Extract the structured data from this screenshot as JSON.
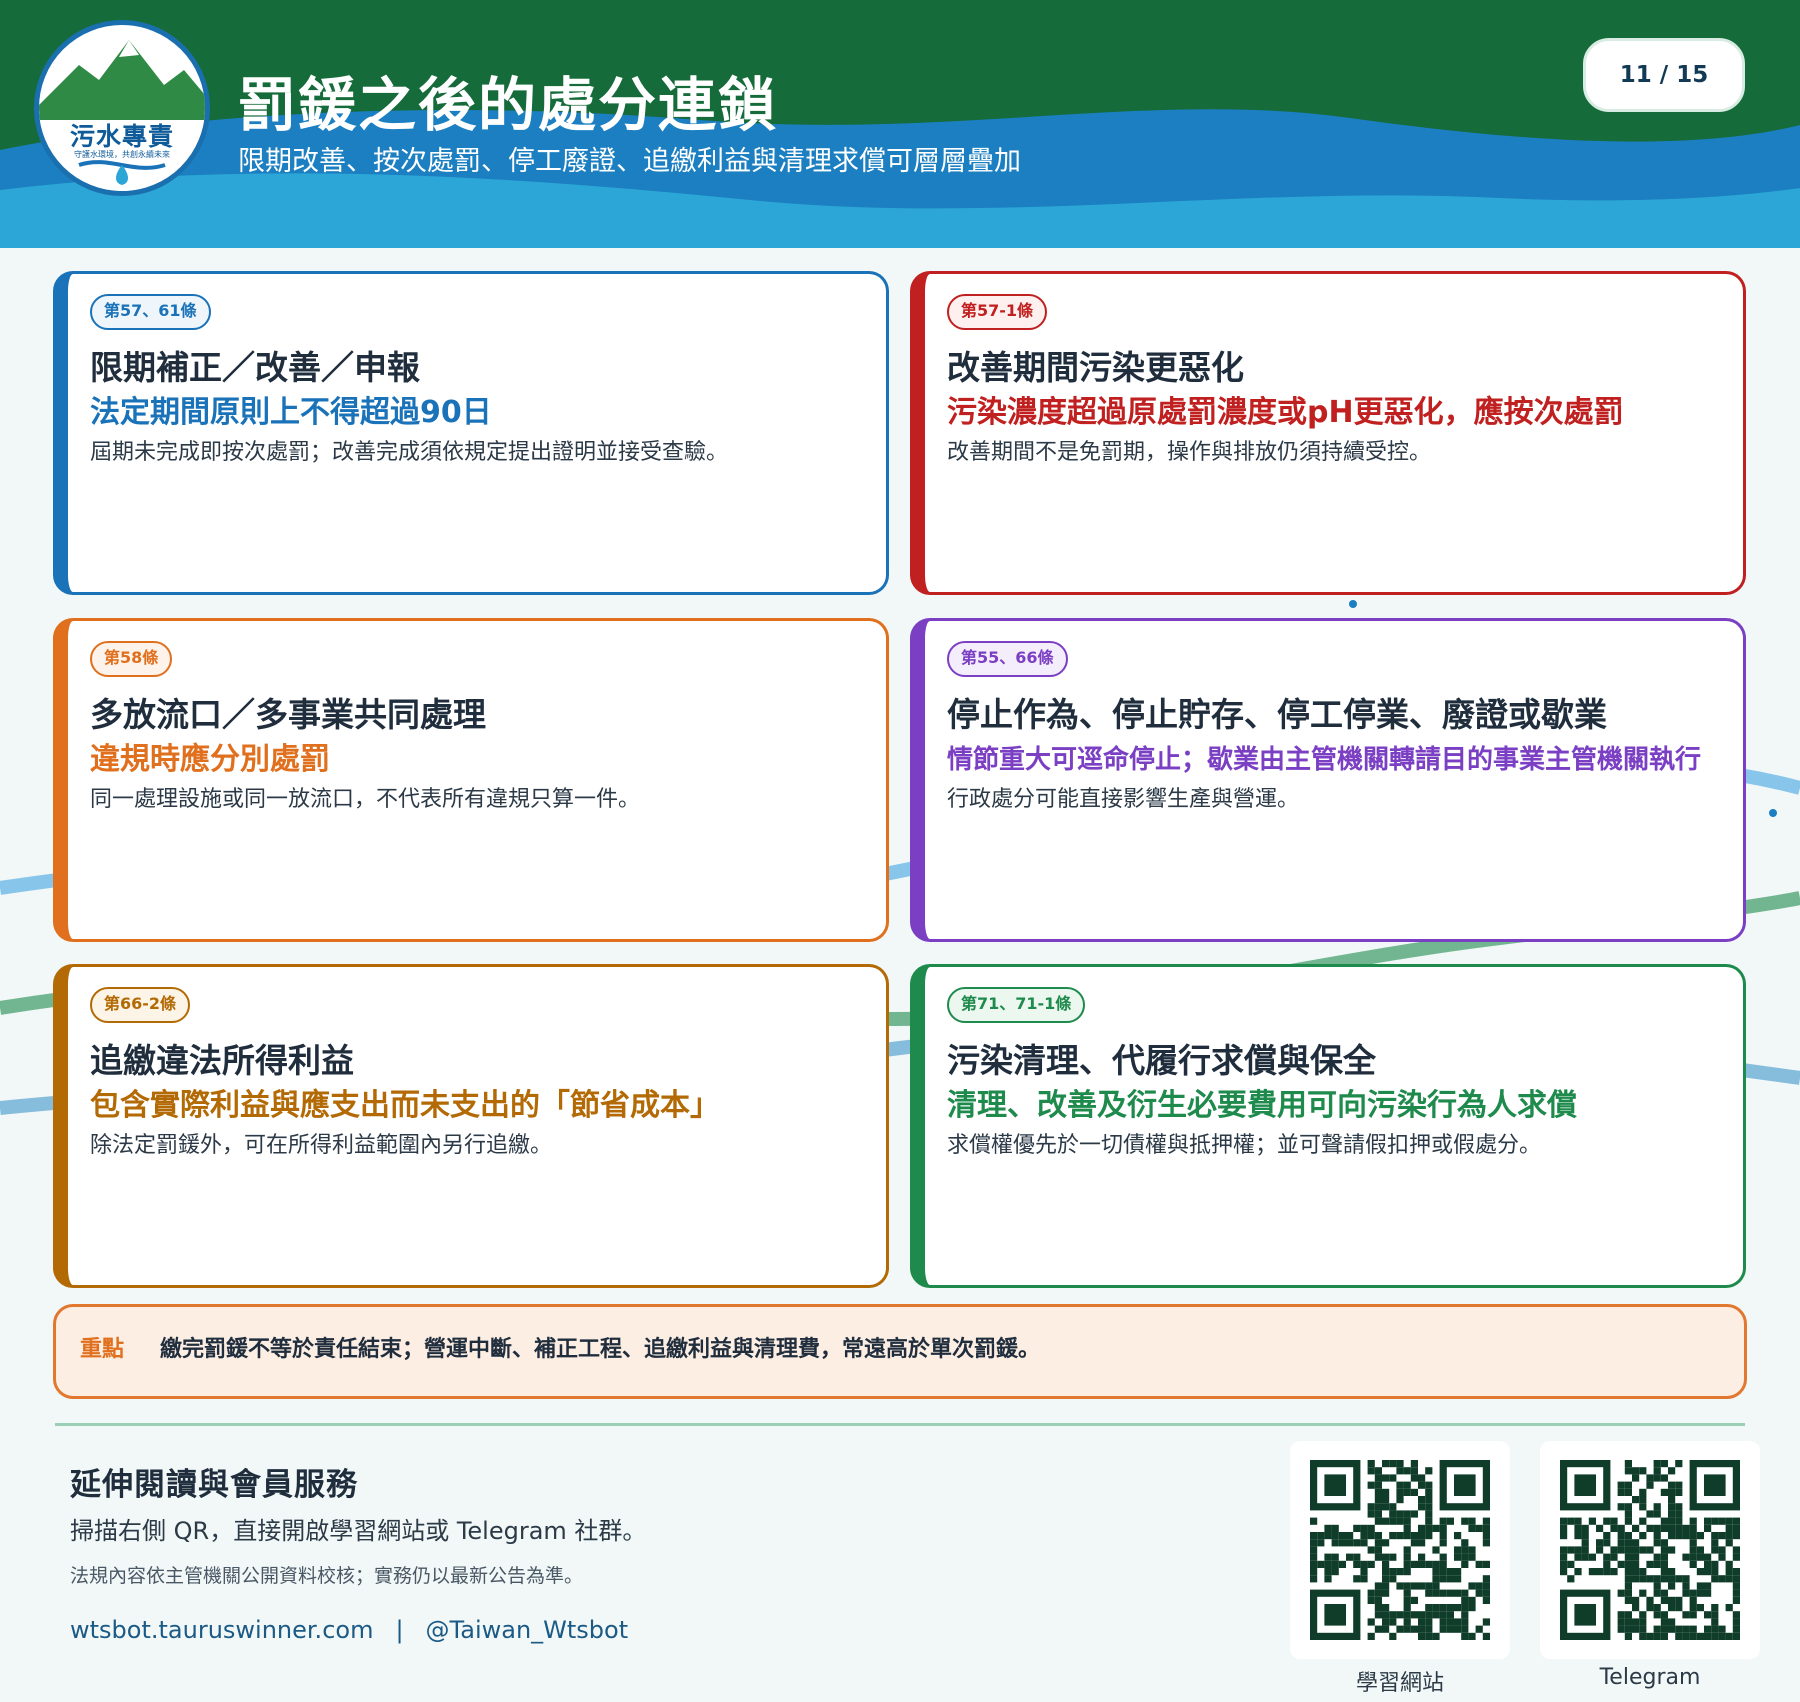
{
  "header": {
    "logo_text": "污水專責",
    "logo_tagline": "守護水環境，共創永續未來",
    "title": "罰鍰之後的處分連鎖",
    "subtitle": "限期改善、按次處罰、停工廢證、追繳利益與清理求償可層層疊加",
    "page_counter": "11 / 15"
  },
  "cards": [
    {
      "badge": "第57、61條",
      "title": "限期補正／改善／申報",
      "highlight": "法定期間原則上不得超過90日",
      "desc": "屆期未完成即按次處罰；改善完成須依規定提出證明並接受查驗。",
      "color": "#1a72b8"
    },
    {
      "badge": "第57-1條",
      "title": "改善期間污染更惡化",
      "highlight": "污染濃度超過原處罰濃度或pH更惡化，應按次處罰",
      "desc": "改善期間不是免罰期，操作與排放仍須持續受控。",
      "color": "#c0201f"
    },
    {
      "badge": "第58條",
      "title": "多放流口／多事業共同處理",
      "highlight": "違規時應分別處罰",
      "desc": "同一處理設施或同一放流口，不代表所有違規只算一件。",
      "color": "#e0701e"
    },
    {
      "badge": "第55、66條",
      "title": "停止作為、停止貯存、停工停業、廢證或歇業",
      "highlight": "情節重大可逕命停止；歇業由主管機關轉請目的事業主管機關執行",
      "desc": "行政處分可能直接影響生產與營運。",
      "color": "#7b3fc4"
    },
    {
      "badge": "第66-2條",
      "title": "追繳違法所得利益",
      "highlight": "包含實際利益與應支出而未支出的「節省成本」",
      "desc": "除法定罰鍰外，可在所得利益範圍內另行追繳。",
      "color": "#b36a05"
    },
    {
      "badge": "第71、71-1條",
      "title": "污染清理、代履行求償與保全",
      "highlight": "清理、改善及衍生必要費用可向污染行為人求償",
      "desc": "求償權優先於一切債權與抵押權；並可聲請假扣押或假處分。",
      "color": "#1e8a4c"
    }
  ],
  "keypoint": {
    "label": "重點",
    "text": "繳完罰鍰不等於責任結束；營運中斷、補正工程、追繳利益與清理費，常遠高於單次罰鍰。"
  },
  "footer": {
    "title": "延伸閱讀與會員服務",
    "text": "掃描右側 QR，直接開啟學習網站或 Telegram 社群。",
    "note": "法規內容依主管機關公開資料校核；實務仍以最新公告為準。",
    "link_site": "wtsbot.tauruswinner.com",
    "separator": "|",
    "link_telegram": "@Taiwan_Wtsbot",
    "qr_site_label": "學習網站",
    "qr_telegram_label": "Telegram"
  }
}
